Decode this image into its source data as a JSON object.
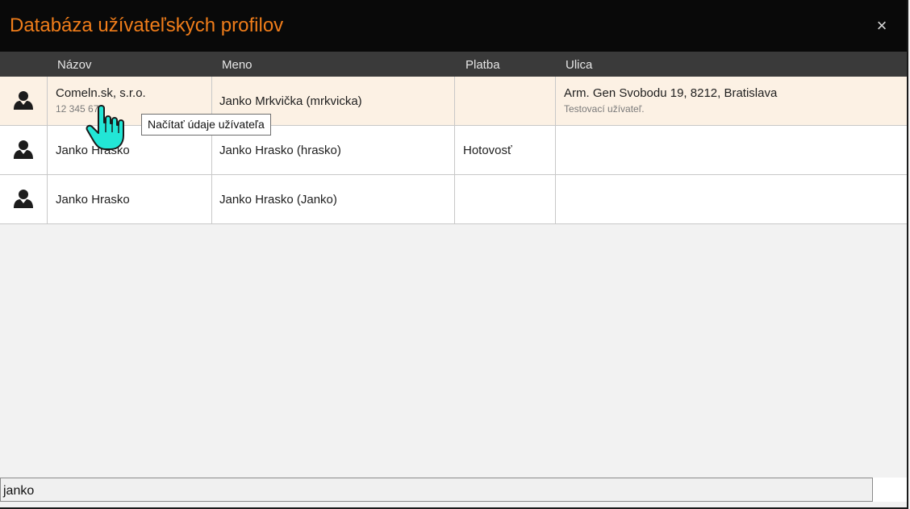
{
  "dialog": {
    "title": "Databáza užívateľských profilov",
    "close_label": "×"
  },
  "table": {
    "columns": [
      "",
      "Názov",
      "Meno",
      "Platba",
      "Ulica"
    ],
    "rows": [
      {
        "icon": "user-icon",
        "name": "Comeln.sk, s.r.o.",
        "name_sub": "12 345 67",
        "meno": "Janko Mrkvička (mrkvicka)",
        "platba": "",
        "ulica": "Arm. Gen Svobodu 19, 8212, Bratislava",
        "ulica_sub": "Testovací užívateľ."
      },
      {
        "icon": "user-icon",
        "name": "Janko Hrasko",
        "name_sub": "",
        "meno": "Janko Hrasko (hrasko)",
        "platba": "Hotovosť",
        "ulica": "",
        "ulica_sub": ""
      },
      {
        "icon": "user-icon",
        "name": "Janko Hrasko",
        "name_sub": "",
        "meno": "Janko Hrasko (Janko)",
        "platba": "",
        "ulica": "",
        "ulica_sub": ""
      }
    ]
  },
  "tooltip": {
    "text": "Načítať údaje užívateľa"
  },
  "search": {
    "value": "janko"
  },
  "colors": {
    "title": "#f07d1a",
    "titlebar": "#090909",
    "header": "#3a3a3a",
    "highlight_row": "#fcf1e4",
    "cursor": "#22e6d6"
  }
}
